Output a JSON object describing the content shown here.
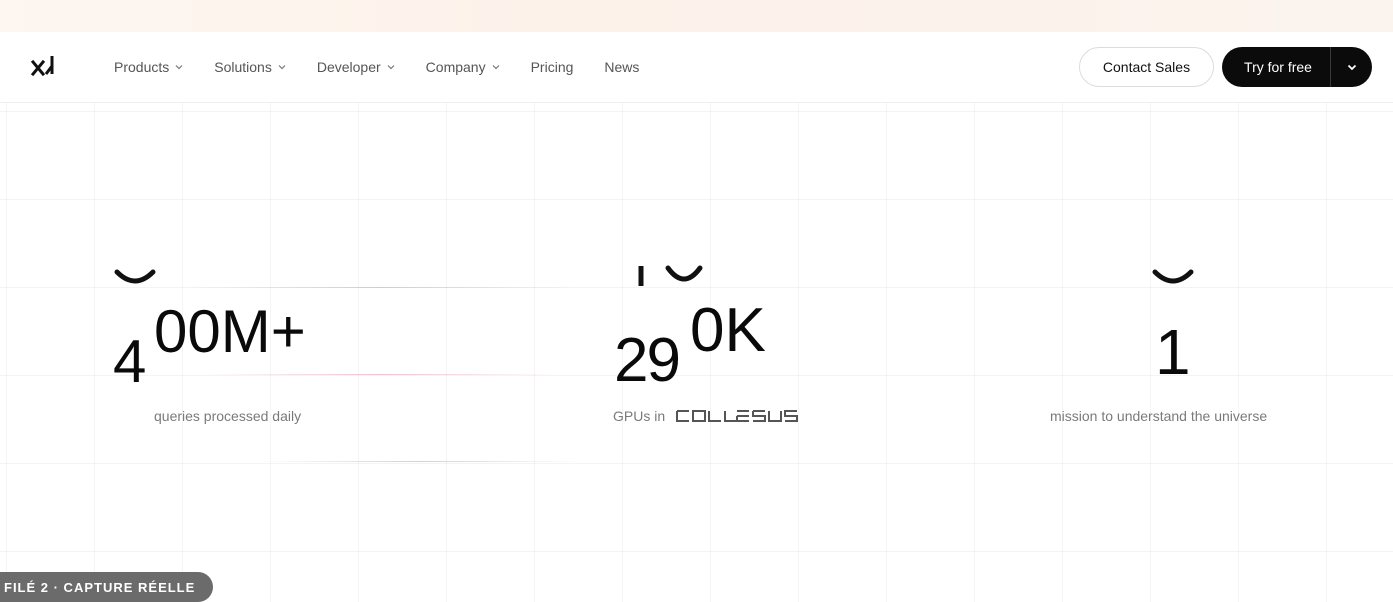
{
  "nav": {
    "logo_icon": "xai-logo-icon",
    "items": [
      {
        "label": "Products",
        "has_dropdown": true
      },
      {
        "label": "Solutions",
        "has_dropdown": true
      },
      {
        "label": "Developer",
        "has_dropdown": true
      },
      {
        "label": "Company",
        "has_dropdown": true
      },
      {
        "label": "Pricing",
        "has_dropdown": false
      },
      {
        "label": "News",
        "has_dropdown": false
      }
    ],
    "contact_label": "Contact Sales",
    "try_label": "Try for free"
  },
  "stats": [
    {
      "value_lead": "4",
      "value_rest": "00M+",
      "caption": "queries processed daily"
    },
    {
      "value_lead": "29",
      "value_rest": "0K",
      "caption": "GPUs in",
      "caption_logo": "COLOSSUS"
    },
    {
      "value_lead": "",
      "value_rest": "1",
      "caption": "mission to understand the universe"
    }
  ],
  "badge": {
    "text": "FILÉ 2 · CAPTURE RÉELLE"
  },
  "colors": {
    "accent_dark": "#0b0b0b",
    "muted_text": "#7a7a7a",
    "badge_bg": "#6b6b6b"
  }
}
